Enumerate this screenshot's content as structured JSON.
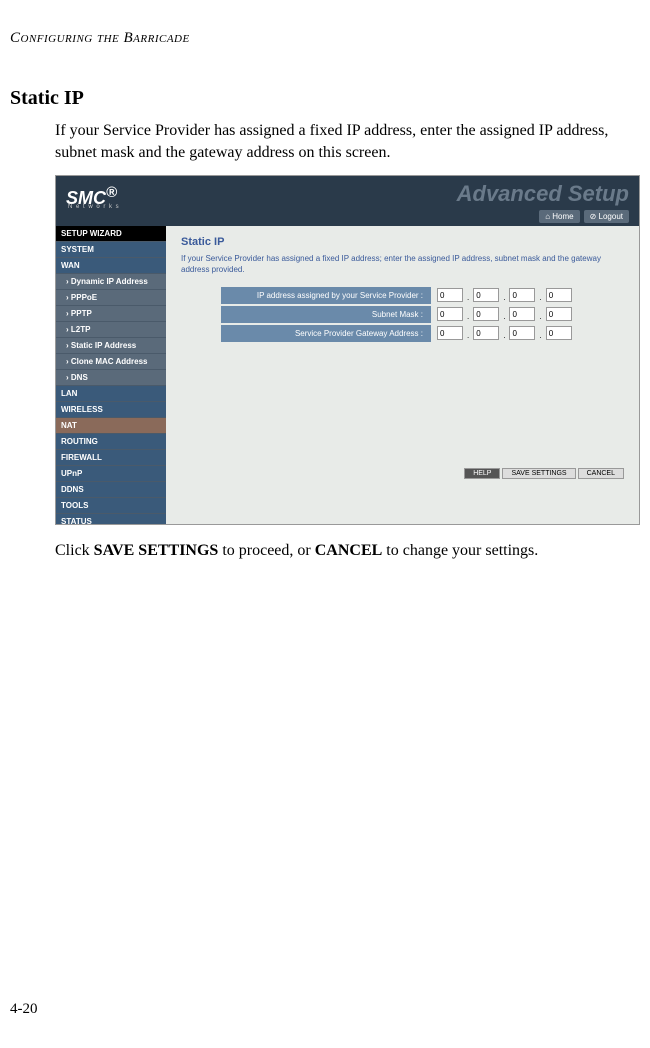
{
  "runningHead": "Configuring the Barricade",
  "sectionTitle": "Static IP",
  "introText": "If your Service Provider has assigned a fixed IP address, enter the assigned IP address, subnet mask and the gateway address on this screen.",
  "screenshot": {
    "logo": "SMC",
    "logoReg": "®",
    "logoSub": "N e t w o r k s",
    "advanced": "Advanced Setup",
    "topBtns": {
      "home": "⌂ Home",
      "logout": "⊘ Logout"
    },
    "sidebar": {
      "setup": "SETUP WIZARD",
      "system": "SYSTEM",
      "wan": "WAN",
      "wanSubs": [
        "Dynamic IP Address",
        "PPPoE",
        "PPTP",
        "L2TP",
        "Static IP Address",
        "Clone MAC Address",
        "DNS"
      ],
      "lan": "LAN",
      "wireless": "WIRELESS",
      "nat": "NAT",
      "routing": "ROUTING",
      "firewall": "FIREWALL",
      "upnp": "UPnP",
      "ddns": "DDNS",
      "tools": "TOOLS",
      "status": "STATUS"
    },
    "main": {
      "title": "Static IP",
      "desc": "If your Service Provider has assigned a fixed IP address; enter the assigned IP address, subnet mask and the gateway address provided.",
      "rows": [
        {
          "label": "IP address assigned by your Service Provider :",
          "values": [
            "0",
            "0",
            "0",
            "0"
          ]
        },
        {
          "label": "Subnet Mask :",
          "values": [
            "0",
            "0",
            "0",
            "0"
          ]
        },
        {
          "label": "Service Provider Gateway Address :",
          "values": [
            "0",
            "0",
            "0",
            "0"
          ]
        }
      ]
    },
    "bottomBtns": {
      "help": "HELP",
      "save": "SAVE SETTINGS",
      "cancel": "CANCEL"
    }
  },
  "postText1": "Click ",
  "postBold1": "SAVE SETTINGS",
  "postText2": " to proceed, or ",
  "postBold2": "CANCEL",
  "postText3": " to change your settings.",
  "pageNum": "4-20"
}
